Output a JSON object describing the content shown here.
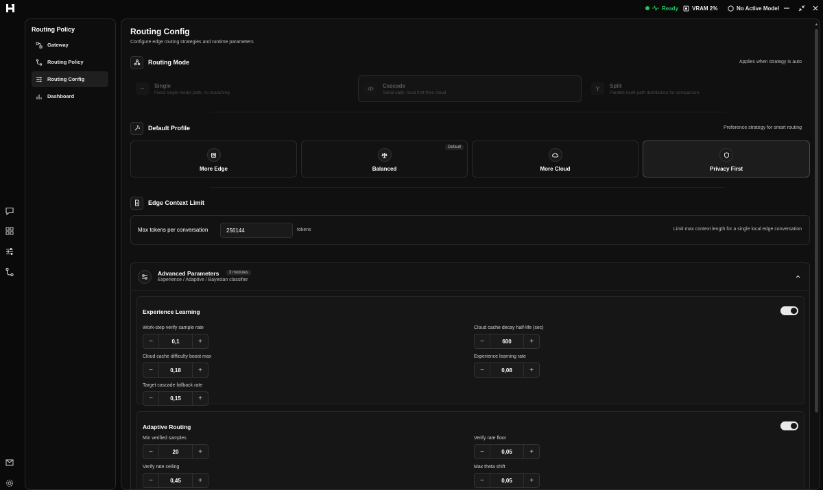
{
  "topbar": {
    "status": "Ready",
    "vram": "VRAM 2%",
    "model": "No Active Model",
    "status_color": "#22c55e"
  },
  "sidebar": {
    "title": "Routing Policy",
    "items": [
      {
        "label": "Gateway",
        "icon": "gateway-icon"
      },
      {
        "label": "Routing Policy",
        "icon": "routing-policy-icon"
      },
      {
        "label": "Routing Config",
        "icon": "sliders-icon",
        "active": true
      },
      {
        "label": "Dashboard",
        "icon": "bar-chart-icon"
      }
    ]
  },
  "main": {
    "title": "Routing Config",
    "subtitle": "Configure edge routing strategies and runtime parameters"
  },
  "routing_mode": {
    "title": "Routing Mode",
    "note": "Applies when strategy is auto",
    "options": [
      {
        "title": "Single",
        "desc": "Fixed single model path, no branching"
      },
      {
        "title": "Cascade",
        "desc": "Serial calls, local first then cloud",
        "active": true
      },
      {
        "title": "Split",
        "desc": "Parallel multi-path distribution for comparison"
      }
    ]
  },
  "default_profile": {
    "title": "Default Profile",
    "note": "Preference strategy for smart routing",
    "default_badge": "Default",
    "options": [
      {
        "label": "More Edge"
      },
      {
        "label": "Balanced"
      },
      {
        "label": "More Cloud"
      },
      {
        "label": "Privacy First",
        "active": true
      }
    ]
  },
  "context_limit": {
    "title": "Edge Context Limit",
    "label": "Max tokens per conversation",
    "value": "256144",
    "unit": "tokens",
    "note": "Limit max context length for a single local edge conversation"
  },
  "advanced": {
    "title": "Advanced Parameters",
    "badge": "3 modules",
    "subtitle": "Experience / Adaptive / Bayesian classifier",
    "experience": {
      "title": "Experience Learning",
      "fields": {
        "verify_rate": {
          "label": "Work-step verify sample rate",
          "value": "0,1"
        },
        "decay": {
          "label": "Cloud cache decay half-life (sec)",
          "value": "600"
        },
        "boost": {
          "label": "Cloud cache difficulty boost max",
          "value": "0,18"
        },
        "learn_rate": {
          "label": "Experience learning rate",
          "value": "0,08"
        },
        "fallback": {
          "label": "Target cascade fallback rate",
          "value": "0,15"
        }
      }
    },
    "adaptive": {
      "title": "Adaptive Routing",
      "fields": {
        "min_samples": {
          "label": "Min verified samples",
          "value": "20"
        },
        "floor": {
          "label": "Verify rate floor",
          "value": "0,05"
        },
        "ceiling": {
          "label": "Verify rate ceiling",
          "value": "0,45"
        },
        "theta": {
          "label": "Max theta shift",
          "value": "0,05"
        }
      }
    },
    "minus": "−",
    "plus": "+"
  }
}
